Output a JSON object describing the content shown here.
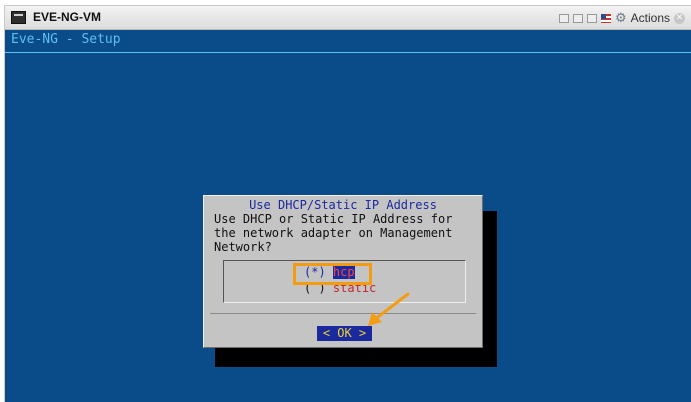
{
  "window": {
    "title": "EVE-NG-VM",
    "actions_label": "Actions",
    "icons": [
      "vm-icon",
      "ctrl-alt-del-icon",
      "fit-icon",
      "fullscreen-icon",
      "keyboard-flag-icon",
      "gear-icon",
      "close-icon"
    ]
  },
  "screen": {
    "title": "Eve-NG - Setup"
  },
  "dialog": {
    "title": "Use DHCP/Static IP Address",
    "message": "Use DHCP or Static IP Address for\nthe network adapter on Management\nNetwork?",
    "options": [
      {
        "marker": "(*)",
        "value": "hcp",
        "selected": true
      },
      {
        "marker": "( )",
        "value": "static",
        "selected": false
      }
    ],
    "ok_button": "< OK >"
  },
  "colors": {
    "screen_bg": "#0a4c8a",
    "accent_text": "#5fbff0",
    "dialog_bg": "#c4c4c4",
    "highlight": "#f39c12",
    "ok_bg": "#1a2a9e",
    "ok_text": "#f0d033"
  }
}
